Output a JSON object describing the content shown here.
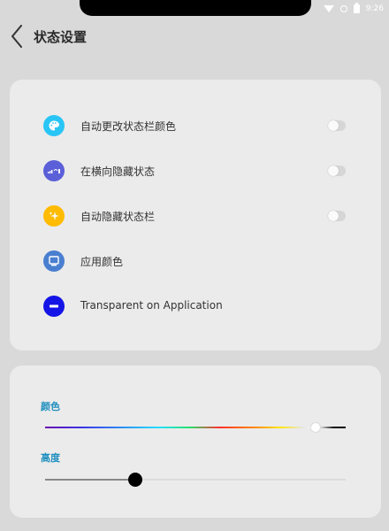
{
  "status_bar": {
    "time": "9:26",
    "icons": [
      "wifi-icon",
      "no-sim-icon",
      "battery-icon"
    ]
  },
  "header": {
    "back_icon": "chevron-left-icon",
    "title": "状态设置"
  },
  "settings": [
    {
      "icon": "palette-icon",
      "icon_color": "#29c5f6",
      "label": "自动更改状态栏颜色",
      "toggle": false
    },
    {
      "icon": "status-bar-icon",
      "icon_color": "#5b5fd8",
      "label": "在横向隐藏状态",
      "toggle": false
    },
    {
      "icon": "sparkle-icon",
      "icon_color": "#ffbb00",
      "label": "自动隐藏状态栏",
      "toggle": false
    },
    {
      "icon": "monitor-icon",
      "icon_color": "#4a7fd0",
      "label": "应用颜色"
    },
    {
      "icon": "minus-circle-icon",
      "icon_color": "#1414e6",
      "label": "Transparent on Application"
    }
  ],
  "color_section": {
    "label": "颜色",
    "hue_value": 0.9
  },
  "height_section": {
    "label": "高度",
    "value": 0.3
  },
  "colors": {
    "accent": "#1f8fbf",
    "background": "#d9d9d9",
    "card": "#ebebeb"
  }
}
